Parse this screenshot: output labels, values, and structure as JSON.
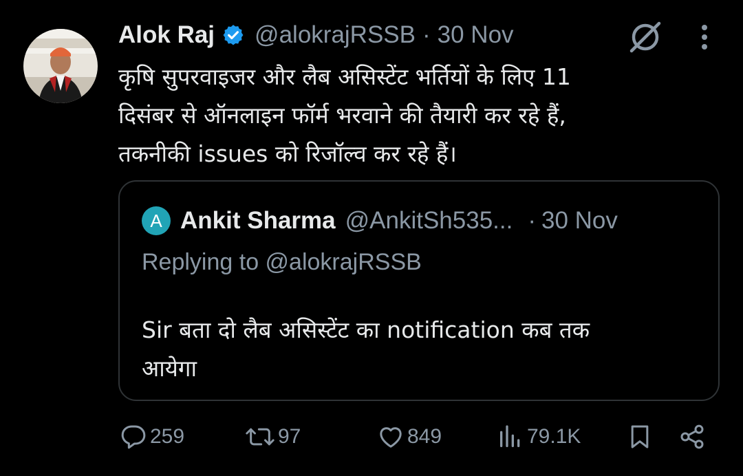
{
  "tweet": {
    "author_name": "Alok Raj",
    "author_handle": "@alokrajRSSB",
    "separator": "·",
    "date": "30 Nov",
    "text_lines": [
      "कृषि सुपरवाइजर और लैब असिस्टेंट भर्तियों के लिए 11",
      "दिसंबर से ऑनलाइन फॉर्म भरवाने की तैयारी कर रहे हैं,",
      "तकनीकी issues को रिजॉल्व कर रहे हैं।"
    ],
    "verified_color": "#1d9bf0"
  },
  "quote": {
    "avatar_letter": "A",
    "avatar_color": "#21a4b6",
    "author_name": "Ankit Sharma",
    "author_handle": "@AnkitSh535...",
    "separator": "·",
    "date": "30 Nov",
    "replying_to": "Replying to @alokrajRSSB",
    "text_lines": [
      "Sir बता दो लैब असिस्टेंट का notification कब तक",
      "आयेगा"
    ]
  },
  "actions": {
    "replies": "259",
    "reposts": "97",
    "likes": "849",
    "views": "79.1K"
  },
  "icons": [
    "grok-icon",
    "more-icon",
    "reply-icon",
    "repost-icon",
    "like-icon",
    "views-icon",
    "bookmark-icon",
    "share-icon"
  ],
  "colors": {
    "background": "#000000",
    "text": "#e7e9ea",
    "muted": "#8b98a5",
    "border": "#2f3336"
  }
}
